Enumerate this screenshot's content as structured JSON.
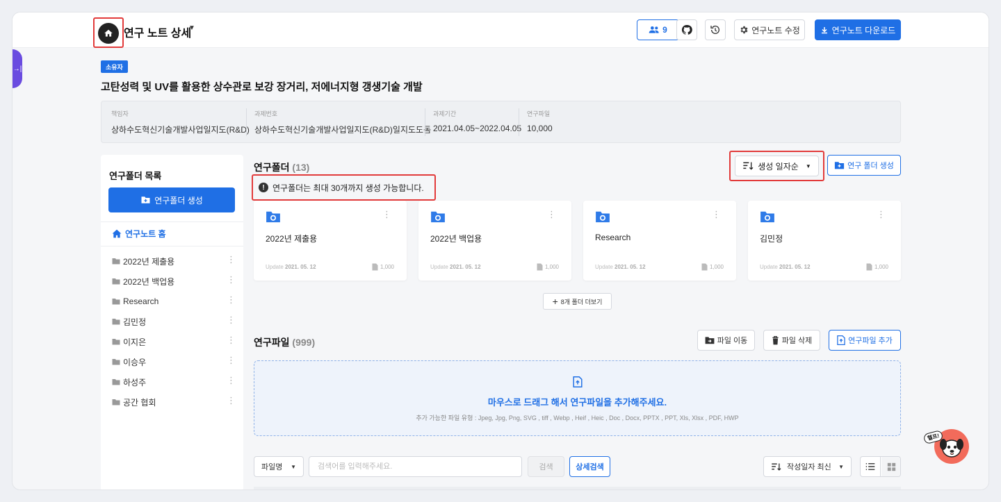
{
  "header": {
    "title": "연구 노트 상세",
    "members_count": "9",
    "edit_label": "연구노트 수정",
    "download_label": "연구노트 다운로드"
  },
  "project": {
    "owner_badge": "소유자",
    "title": "고탄성력 및 UV를 활용한 상수관로 보강 장거리, 저에너지형 갱생기술 개발",
    "info": [
      {
        "label": "책임자",
        "value": "상하수도혁신기술개발사업일지도(R&D)"
      },
      {
        "label": "과제번호",
        "value": "상하수도혁신기술개발사업일지도(R&D)일지도도돔"
      },
      {
        "label": "과제기간",
        "value": "2021.04.05~2022.04.05"
      },
      {
        "label": "연구파일",
        "value": "10,000"
      }
    ]
  },
  "sidebar": {
    "heading": "연구폴더 목록",
    "create_label": "연구폴더 생성",
    "home_label": "연구노트 홈",
    "folders": [
      "2022년 제출용",
      "2022년 백업용",
      "Research",
      "김민정",
      "이지은",
      "이승우",
      "하성주",
      "공간 협회"
    ]
  },
  "folders_section": {
    "title": "연구폴더",
    "count": "(13)",
    "sort_label": "생성 일자순",
    "create_label": "연구 폴더 생성",
    "notice": "연구폴더는 최대 30개까지 생성 가능합니다.",
    "update_prefix": "Update",
    "cards": [
      {
        "name": "2022년 제출용",
        "date": "2021. 05. 12",
        "size": "1,000"
      },
      {
        "name": "2022년 백업용",
        "date": "2021. 05. 12",
        "size": "1,000"
      },
      {
        "name": "Research",
        "date": "2021. 05. 12",
        "size": "1,000"
      },
      {
        "name": "김민정",
        "date": "2021. 05. 12",
        "size": "1,000"
      }
    ],
    "more_label": "8개 폴더 더보기"
  },
  "files_section": {
    "title": "연구파일",
    "count": "(999)",
    "move_label": "파일 이동",
    "delete_label": "파일 삭제",
    "add_label": "연구파일 추가",
    "drop_main": "마우스로 드래그 해서 연구파일을 추가해주세요.",
    "drop_sub": "추가 가능한 파일 유형 : Jpeg, Jpg, Png, SVG , tiff , Webp , Heif , Heic , Doc , Docx, PPTX , PPT, Xls, Xlsx , PDF, HWP",
    "filter_label": "파일명",
    "search_placeholder": "검색어를 입력해주세요.",
    "search_label": "검색",
    "advanced_label": "상세검색",
    "sort_label": "작성일자 최신"
  },
  "helper": {
    "tag": "헬프!"
  },
  "colors": {
    "primary": "#1f6fe5",
    "highlight": "#e23a3a",
    "side_tab": "#6a4ce0",
    "helper": "#f26b5b"
  }
}
